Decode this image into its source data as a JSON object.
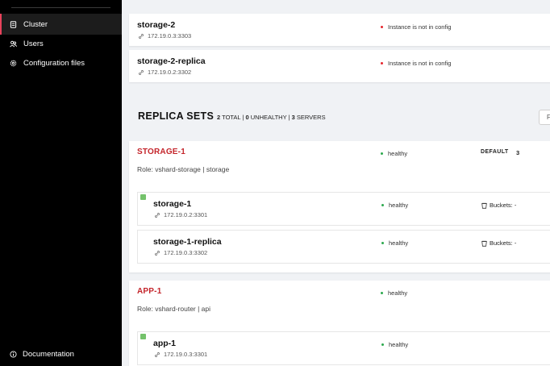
{
  "sidebar": {
    "items": [
      {
        "label": "Cluster",
        "icon": "server-icon",
        "active": true
      },
      {
        "label": "Users",
        "icon": "users-icon"
      },
      {
        "label": "Configuration files",
        "icon": "gear-icon"
      }
    ],
    "footer": {
      "label": "Documentation",
      "icon": "info-icon"
    }
  },
  "unconfigured": [
    {
      "name": "storage-2",
      "address": "172.19.0.3:3303",
      "status": "Instance is not in config"
    },
    {
      "name": "storage-2-replica",
      "address": "172.19.0.2:3302",
      "status": "Instance is not in config"
    }
  ],
  "replicasets": {
    "title": "REPLICA SETS",
    "stats": {
      "total": "2",
      "total_label": "TOTAL",
      "unhealthy": "0",
      "unhealthy_label": "UNHEALTHY",
      "servers": "3",
      "servers_label": "SERVERS",
      "sep": "|"
    },
    "filter_label": "F",
    "sets": [
      {
        "name": "STORAGE-1",
        "status": "healthy",
        "role": "Role: vshard-storage | storage",
        "group": "DEFAULT",
        "weight": "3",
        "instances": [
          {
            "name": "storage-1",
            "address": "172.19.0.2:3301",
            "status": "healthy",
            "buckets": "Buckets: -",
            "leader": true
          },
          {
            "name": "storage-1-replica",
            "address": "172.19.0.3:3302",
            "status": "healthy",
            "buckets": "Buckets: -",
            "leader": false
          }
        ]
      },
      {
        "name": "APP-1",
        "status": "healthy",
        "role": "Role: vshard-router | api",
        "instances": [
          {
            "name": "app-1",
            "address": "172.19.0.3:3301",
            "status": "healthy",
            "leader": true
          }
        ]
      }
    ]
  },
  "colors": {
    "accent": "#c4252b",
    "healthy": "#2da94f",
    "error": "#e5262e",
    "leader": "#74c26b"
  }
}
